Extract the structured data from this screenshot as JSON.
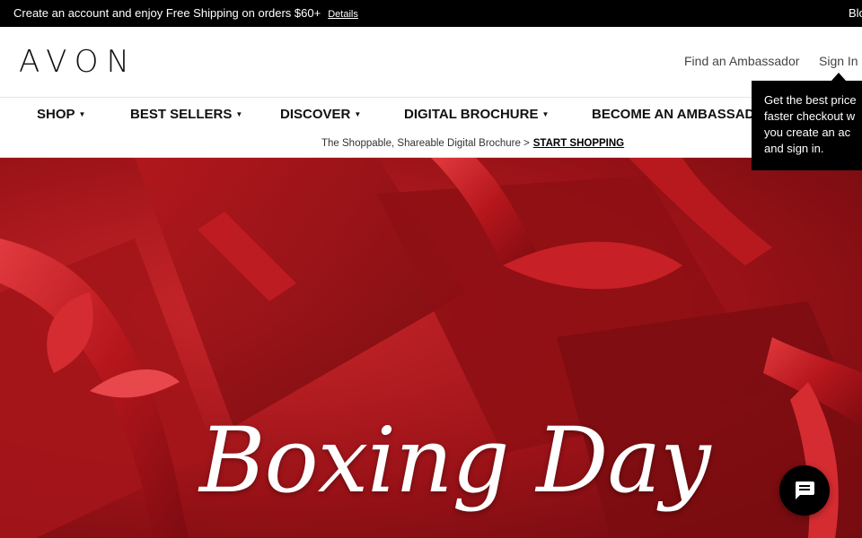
{
  "topbar": {
    "promo_text": "Create an account and enjoy Free Shipping on orders $60+",
    "details_link": "Details",
    "right_text": "Blo"
  },
  "header": {
    "logo": "AVON",
    "find_ambassador": "Find an Ambassador",
    "sign_in": "Sign In"
  },
  "nav": {
    "items": [
      {
        "label": "SHOP",
        "caret": "▼"
      },
      {
        "label": "BEST SELLERS",
        "caret": "▼"
      },
      {
        "label": "DISCOVER",
        "caret": "▼"
      },
      {
        "label": "DIGITAL BROCHURE",
        "caret": "▼"
      },
      {
        "label": "BECOME AN AMBASSADOR",
        "caret": ""
      }
    ]
  },
  "subbar": {
    "text": "The Shoppable, Shareable Digital Brochure >",
    "cta": "START SHOPPING"
  },
  "tooltip": {
    "lines": [
      "Get the best price",
      "faster checkout w",
      "you create an ac",
      "and sign in."
    ]
  },
  "hero": {
    "title": "Boxing Day"
  },
  "chat": {
    "icon": "chat-bubble-icon"
  },
  "colors": {
    "topbar_bg": "#000000",
    "hero_red": "#b01c22",
    "text_dark": "#111111"
  }
}
